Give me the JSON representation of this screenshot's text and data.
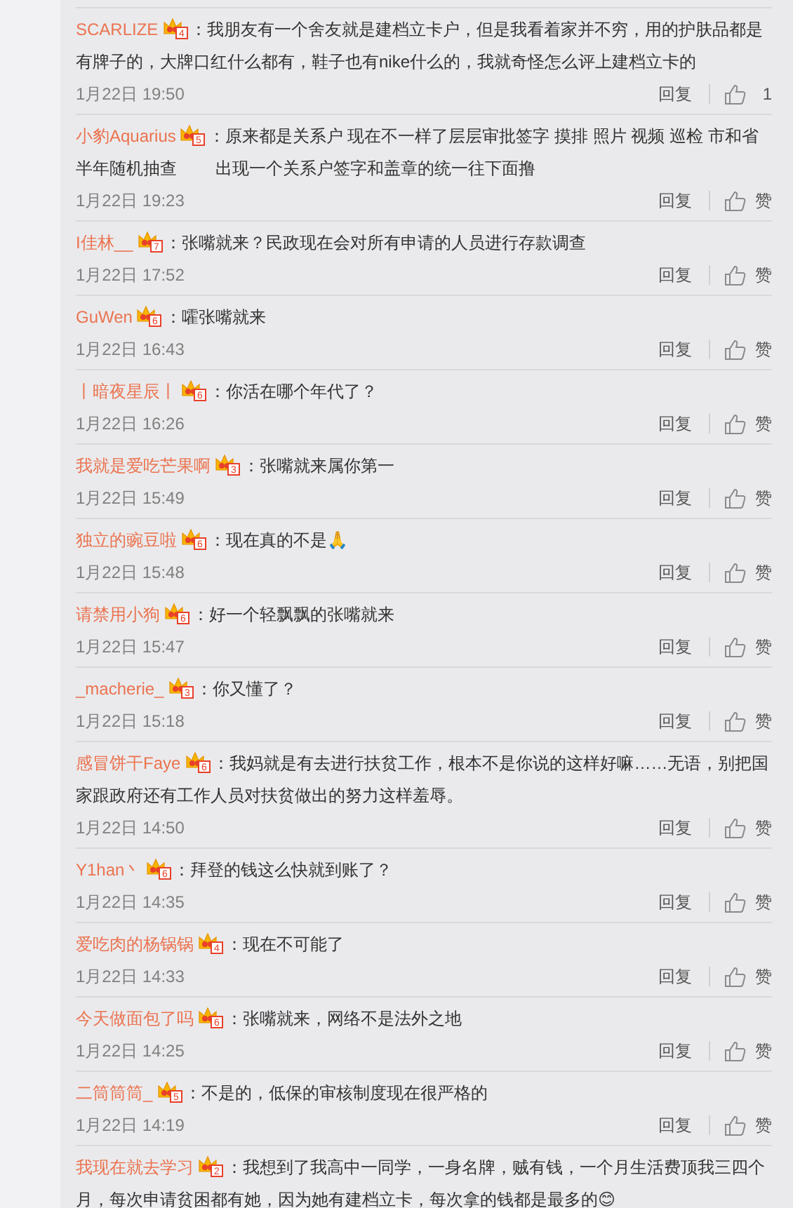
{
  "comments": [
    {
      "user": "SCARLIZE",
      "badge": "4",
      "sep": "：",
      "text": "我朋友有一个舍友就是建档立卡户，但是我看着家并不穷，用的护肤品都是有牌子的，大牌口红什么都有，鞋子也有nike什么的，我就奇怪怎么评上建档立卡的",
      "time": "1月22日 19:50",
      "reply": "回复",
      "like": "1"
    },
    {
      "user": "小豹Aquarius",
      "badge": "5",
      "sep": "：",
      "text": "原来都是关系户 现在不一样了层层审批签字 摸排 照片 视频 巡检 市和省半年随机抽查 　　出现一个关系户签字和盖章的统一往下面撸",
      "time": "1月22日 19:23",
      "reply": "回复",
      "like": "赞"
    },
    {
      "user": "I佳林__",
      "badge": "7",
      "sep": "：",
      "text": "张嘴就来？民政现在会对所有申请的人员进行存款调查",
      "time": "1月22日 17:52",
      "reply": "回复",
      "like": "赞"
    },
    {
      "user": "GuWen",
      "badge": "6",
      "sep": "：",
      "text": "嚯张嘴就来",
      "time": "1月22日 16:43",
      "reply": "回复",
      "like": "赞"
    },
    {
      "user": "丨暗夜星辰丨",
      "badge": "6",
      "sep": "：",
      "text": "你活在哪个年代了？",
      "time": "1月22日 16:26",
      "reply": "回复",
      "like": "赞"
    },
    {
      "user": "我就是爱吃芒果啊",
      "badge": "3",
      "sep": "：",
      "text": "张嘴就来属你第一",
      "time": "1月22日 15:49",
      "reply": "回复",
      "like": "赞"
    },
    {
      "user": "独立的豌豆啦",
      "badge": "6",
      "sep": "：",
      "text": "现在真的不是🙏",
      "time": "1月22日 15:48",
      "reply": "回复",
      "like": "赞"
    },
    {
      "user": "请禁用小狗",
      "badge": "6",
      "sep": "：",
      "text": "好一个轻飘飘的张嘴就来",
      "time": "1月22日 15:47",
      "reply": "回复",
      "like": "赞"
    },
    {
      "user": "_macherie_",
      "badge": "3",
      "sep": "：",
      "text": "你又懂了？",
      "time": "1月22日 15:18",
      "reply": "回复",
      "like": "赞"
    },
    {
      "user": "感冒饼干Faye",
      "badge": "6",
      "sep": "：",
      "text": "我妈就是有去进行扶贫工作，根本不是你说的这样好嘛……无语，别把国家跟政府还有工作人员对扶贫做出的努力这样羞辱。",
      "time": "1月22日 14:50",
      "reply": "回复",
      "like": "赞"
    },
    {
      "user": "Y1han丶",
      "badge": "6",
      "sep": "：",
      "text": "拜登的钱这么快就到账了？",
      "time": "1月22日 14:35",
      "reply": "回复",
      "like": "赞"
    },
    {
      "user": "爱吃肉的杨锅锅",
      "badge": "4",
      "sep": "：",
      "text": "现在不可能了",
      "time": "1月22日 14:33",
      "reply": "回复",
      "like": "赞"
    },
    {
      "user": "今天做面包了吗",
      "badge": "6",
      "sep": "：",
      "text": "张嘴就来，网络不是法外之地",
      "time": "1月22日 14:25",
      "reply": "回复",
      "like": "赞"
    },
    {
      "user": "二筒筒筒_",
      "badge": "5",
      "sep": "：",
      "text": "不是的，低保的审核制度现在很严格的",
      "time": "1月22日 14:19",
      "reply": "回复",
      "like": "赞"
    },
    {
      "user": "我现在就去学习",
      "badge": "2",
      "sep": "：",
      "text": "我想到了我高中一同学，一身名牌，贼有钱，一个月生活费顶我三四个月，每次申请贫困都有她，因为她有建档立卡，每次拿的钱都是最多的😊"
    }
  ]
}
